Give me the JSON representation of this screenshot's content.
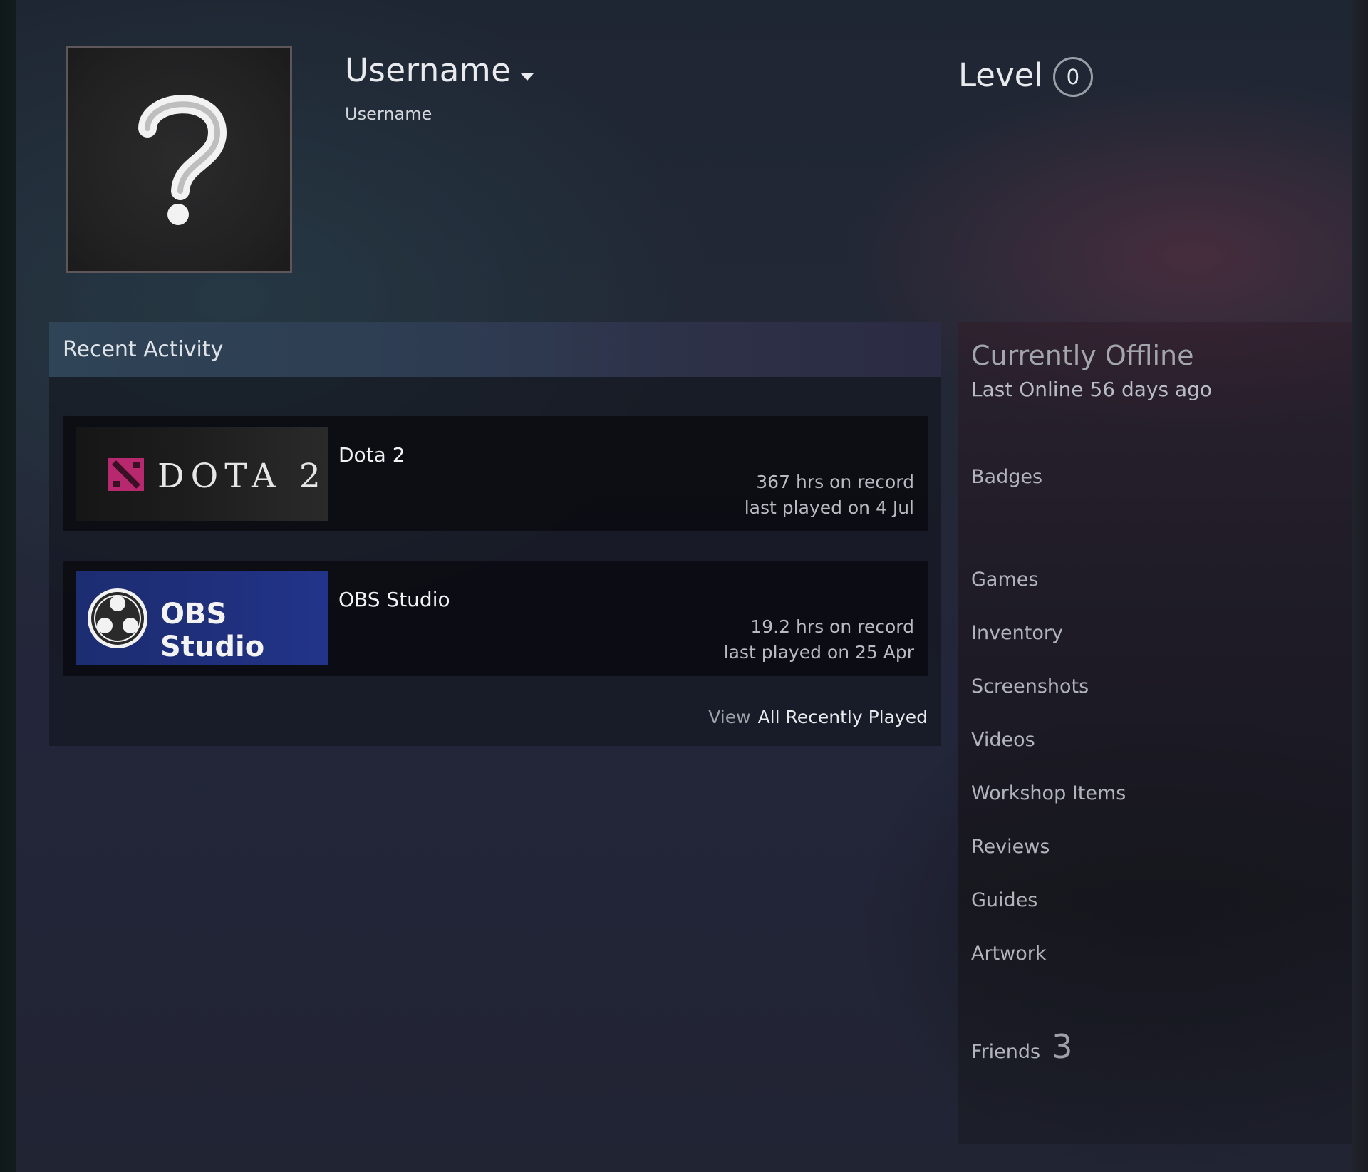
{
  "profile": {
    "persona_name": "Username",
    "real_name": "Username",
    "level_label": "Level",
    "level_value": "0",
    "avatar_icon": "question-mark-icon"
  },
  "recent_activity": {
    "title": "Recent Activity",
    "games": [
      {
        "name": "Dota 2",
        "logo_text": "DOTA 2",
        "hours": "367 hrs on record",
        "last_played": "last played on 4 Jul"
      },
      {
        "name": "OBS Studio",
        "logo_text": "OBS Studio",
        "hours": "19.2 hrs on record",
        "last_played": "last played on 25 Apr"
      }
    ],
    "view_prefix": "View",
    "view_link": "All Recently Played"
  },
  "sidebar": {
    "status": "Currently Offline",
    "last_online": "Last Online 56 days ago",
    "links": {
      "badges": "Badges",
      "games": "Games",
      "inventory": "Inventory",
      "screenshots": "Screenshots",
      "videos": "Videos",
      "workshop": "Workshop Items",
      "reviews": "Reviews",
      "guides": "Guides",
      "artwork": "Artwork"
    },
    "friends_label": "Friends",
    "friends_count": "3"
  },
  "colors": {
    "dota_accent": "#c0266a",
    "obs_blue": "#1f2f7a"
  }
}
